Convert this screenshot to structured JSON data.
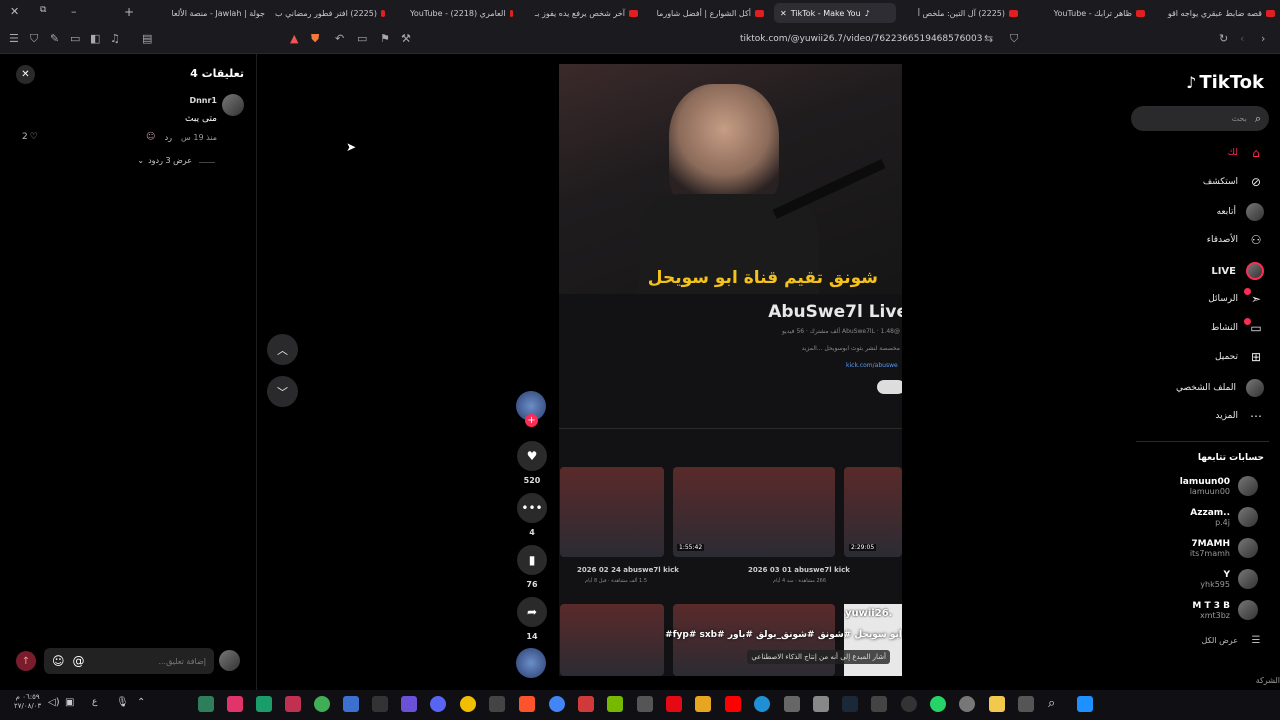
{
  "tabs": [
    {
      "label": "جولة | Jawlah - منصة الألعا"
    },
    {
      "label": "(2225) افتر فطور رمضاني ب"
    },
    {
      "label": "العامري (2218) - YouTube"
    },
    {
      "label": "آخر شخص يرفع يده يفوز بـ"
    },
    {
      "label": "أكل الشوارع | أفضل شاورما"
    },
    {
      "label": "TikTok - Make You"
    },
    {
      "label": "(2225) آل التين: ملخص أ"
    },
    {
      "label": "ظاهر ترابك - YouTube"
    },
    {
      "label": "قصه ضابط عبقري يواجه اقو"
    }
  ],
  "url": "tiktok.com/@yuwii26.7/video/7622366519468576003",
  "comments": {
    "title": "تعليقات 4",
    "user": "Dnnr1",
    "text": "متى يبث",
    "time": "منذ 19 س",
    "reply": "رد",
    "likes": "2",
    "view_replies": "عرض 3 ردود",
    "input_placeholder": "إضافة تعليق...",
    "at": "@"
  },
  "video": {
    "caption_title": "شونق تقيم قناة ابو سويحل",
    "channel_name": "AbuSwe7l Live",
    "channel_meta": "@AbuSwe7lL · 1.48 ألف مشترك · 56 فيديو",
    "channel_desc": "مخصصة لنشر بثوث ابوسويحل ...المزيد",
    "channel_link": "kick.com/abuswe",
    "thumbs": [
      {
        "title": "2026 02 24 abuswe7l kick",
        "meta": "1.5 ألف مشاهدة · قبل 8 أيام",
        "duration": ""
      },
      {
        "title": "2026 03 01 abuswe7l kick",
        "meta": "266 مشاهدة · منذ 4 أيام",
        "duration": "1:55:42"
      },
      {
        "title": "",
        "meta": "",
        "duration": "2:29:05"
      }
    ],
    "watermark": "yuwii26.",
    "hashtags": "ابو سويحل #شونق #شونق_بولق #باور #fyp# sxb#",
    "ai_notice": "أشار المبدع إلى أنه من إنتاج الذكاء الاصطناعي"
  },
  "actions": {
    "likes": "520",
    "comments": "4",
    "saves": "76",
    "shares": "14"
  },
  "sidebar": {
    "logo": "TikTok",
    "search_placeholder": "بحث",
    "nav": [
      {
        "label": "لك",
        "icon": "home-icon"
      },
      {
        "label": "استكشف",
        "icon": "compass-icon"
      },
      {
        "label": "أتابعه",
        "icon": "avatar"
      },
      {
        "label": "الأصدقاء",
        "icon": "friends-icon"
      },
      {
        "label": "LIVE",
        "icon": "live-icon"
      },
      {
        "label": "الرسائل",
        "icon": "send-icon"
      },
      {
        "label": "النشاط",
        "icon": "activity-icon"
      },
      {
        "label": "تحميل",
        "icon": "upload-icon"
      },
      {
        "label": "الملف الشخصي",
        "icon": "avatar"
      },
      {
        "label": "المزيد",
        "icon": "more-icon"
      }
    ],
    "following_title": "حسابات تتابعها",
    "following": [
      {
        "name": "lamuun00",
        "handle": "lamuun00"
      },
      {
        "name": "Azzam..",
        "handle": "p.4j"
      },
      {
        "name": "7MAMH",
        "handle": "its7mamh"
      },
      {
        "name": "Y",
        "handle": "yhk595"
      },
      {
        "name": "M T 3 B",
        "handle": "xmt3bz"
      }
    ],
    "see_all": "عرض الكل",
    "company": "الشركة"
  },
  "taskbar": {
    "time": "٠٦:٥٩ م",
    "date": "٢٧/٠٨/٠٣"
  }
}
